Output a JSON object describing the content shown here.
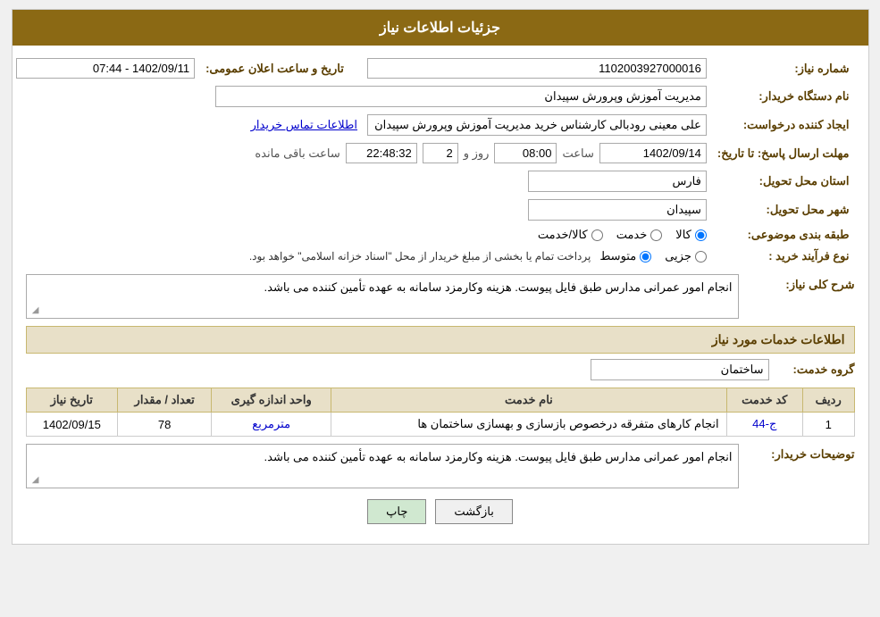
{
  "header": {
    "title": "جزئیات اطلاعات نیاز"
  },
  "fields": {
    "shomareNiaz_label": "شماره نیاز:",
    "shomareNiaz_value": "1102003927000016",
    "namDastgah_label": "نام دستگاه خریدار:",
    "namDastgah_value": "مدیریت آموزش وپرورش سپیدان",
    "ijadKonande_label": "ایجاد کننده درخواست:",
    "ijadKonande_value": "علی معینی رودبالی کارشناس خرید مدیریت آموزش وپرورش سپیدان",
    "ijadKonande_link": "اطلاعات تماس خریدار",
    "mohlat_label": "مهلت ارسال پاسخ: تا تاریخ:",
    "mohlat_date": "1402/09/14",
    "mohlat_saat_label": "ساعت",
    "mohlat_saat_value": "08:00",
    "mohlat_roz_label": "روز و",
    "mohlat_roz_value": "2",
    "mohlat_saat_mande_label": "ساعت باقی مانده",
    "mohlat_saat_mande_value": "22:48:32",
    "ostan_label": "استان محل تحویل:",
    "ostan_value": "فارس",
    "shahr_label": "شهر محل تحویل:",
    "shahr_value": "سپیدان",
    "tabaqe_label": "طبقه بندی موضوعی:",
    "tabaqe_options": [
      "کالا",
      "خدمت",
      "کالا/خدمت"
    ],
    "tabaqe_selected": "کالا",
    "noveFarayand_label": "نوع فرآیند خرید :",
    "noveFarayand_options": [
      "جزیی",
      "متوسط"
    ],
    "noveFarayand_note": "پرداخت تمام یا بخشی از مبلغ خریدار از محل \"اسناد خزانه اسلامی\" خواهد بود.",
    "noveFarayand_selected": "متوسط",
    "sharhKoli_label": "شرح کلی نیاز:",
    "sharhKoli_value": "انجام امور عمرانی مدارس طبق فایل پیوست. هزینه وکارمزد سامانه به عهده تأمین کننده می باشد.",
    "section_khadamat": "اطلاعات خدمات مورد نیاز",
    "gorohKhadamat_label": "گروه خدمت:",
    "gorohKhadamat_value": "ساختمان",
    "table_headers": [
      "ردیف",
      "کد خدمت",
      "نام خدمت",
      "واحد اندازه گیری",
      "تعداد / مقدار",
      "تاریخ نیاز"
    ],
    "table_rows": [
      {
        "radif": "1",
        "kod": "ج-44",
        "name": "انجام کارهای متفرقه درخصوص بازسازی و بهسازی ساختمان ها",
        "vahed": "مترمربع",
        "tedad": "78",
        "tarikh": "1402/09/15"
      }
    ],
    "tosifat_label": "توضیحات خریدار:",
    "tosifat_value": "انجام امور عمرانی مدارس طبق فایل پیوست. هزینه وکارمزد سامانه به عهده تأمین کننده می باشد.",
    "btn_print": "چاپ",
    "btn_back": "بازگشت",
    "tarikh_label": "تاریخ و ساعت اعلان عمومی:",
    "tarikh_value": "1402/09/11 - 07:44"
  }
}
